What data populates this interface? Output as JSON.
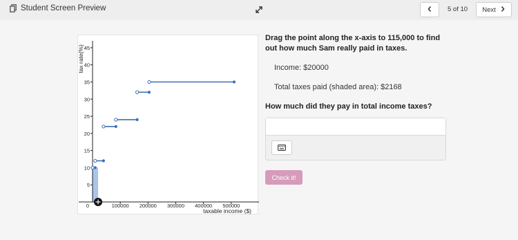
{
  "header": {
    "title": "Student Screen Preview",
    "page_count": "5 of 10",
    "next_label": "Next",
    "icons": [
      "copy-icon",
      "expand-icon",
      "chevron-left-icon",
      "chevron-right-icon"
    ]
  },
  "question": {
    "prompt": "Drag the point along the x-axis to 115,000 to find out how much Sam really paid in taxes.",
    "income": "Income: $20000",
    "taxes_paid": "Total taxes paid (shaded area): $2168",
    "followup": "How much did they pay in total income taxes?",
    "answer_value": "",
    "check_label": "Check it!"
  },
  "colors": {
    "accent": "#3b6fb6",
    "shade": "#a9c6ea",
    "check_button": "#d69bbb"
  },
  "chart_data": {
    "type": "line",
    "xlabel": "taxable income ($)",
    "ylabel": "tax rate(%)",
    "x_ticks": [
      "0",
      "100000",
      "200000",
      "300000",
      "400000",
      "500000"
    ],
    "y_ticks": [
      "5",
      "10",
      "15",
      "20",
      "25",
      "30",
      "35",
      "40",
      "45"
    ],
    "xlim": [
      0,
      600000
    ],
    "ylim": [
      0,
      47
    ],
    "series": [
      {
        "segments": [
          {
            "x": [
              0,
              9700
            ],
            "y": [
              10,
              10
            ]
          },
          {
            "x": [
              9700,
              39500
            ],
            "y": [
              12,
              12
            ]
          },
          {
            "x": [
              39500,
              84200
            ],
            "y": [
              22,
              22
            ]
          },
          {
            "x": [
              84200,
              160700
            ],
            "y": [
              24,
              24
            ]
          },
          {
            "x": [
              160700,
              204100
            ],
            "y": [
              32,
              32
            ]
          },
          {
            "x": [
              204100,
              510300
            ],
            "y": [
              35,
              35
            ]
          }
        ]
      }
    ],
    "draggable_point": {
      "x": 20000,
      "y": 0
    },
    "shaded_to_x": 20000
  }
}
